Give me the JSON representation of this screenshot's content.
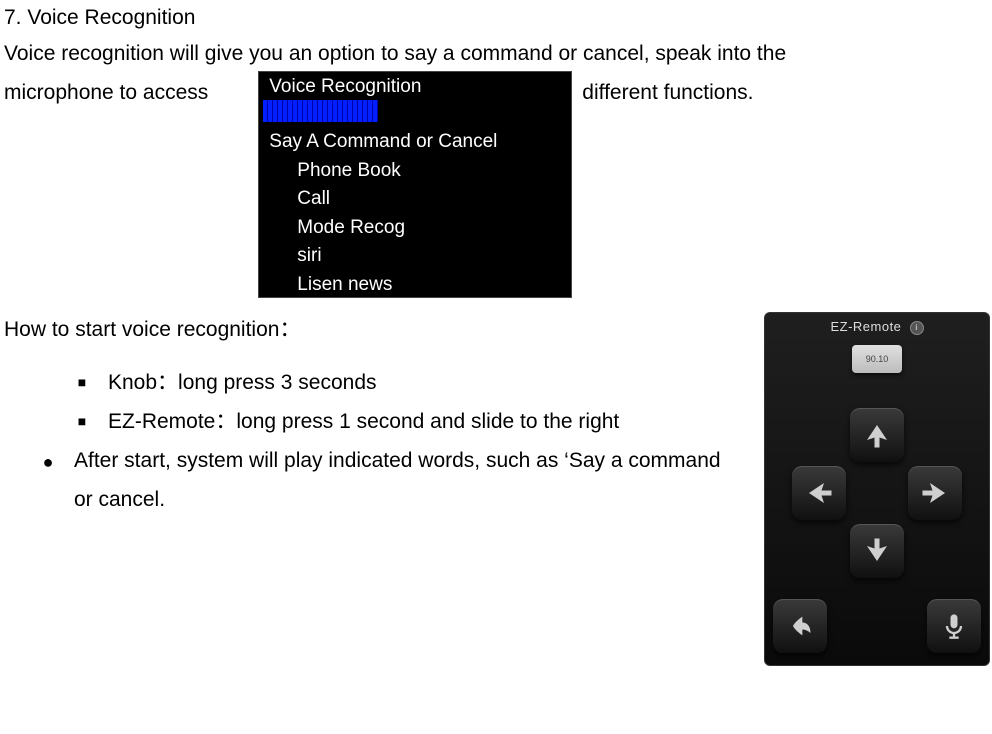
{
  "section": {
    "heading": "7. Voice Recognition",
    "intro_line1": "Voice recognition will give you an option to say a command or cancel, speak into the",
    "intro_left": "microphone to access",
    "intro_right": "different functions."
  },
  "vr_screen": {
    "title": "Voice Recognition",
    "prompt": "Say A Command or Cancel",
    "items": [
      "Phone Book",
      "Call",
      "Mode Recog",
      "siri",
      "Lisen news"
    ]
  },
  "howto": {
    "title": "How to start voice recognition：",
    "bullets_square": [
      "Knob：long press 3 seconds",
      "EZ-Remote：long press 1 second and slide to the right"
    ],
    "bullet_circle": "After start, system will play indicated words, such as ‘Say a command or cancel."
  },
  "remote": {
    "label": "EZ-Remote",
    "badge": "90.10",
    "icons": {
      "up": "arrow-up-icon",
      "down": "arrow-down-icon",
      "left": "arrow-left-icon",
      "right": "arrow-right-icon",
      "back": "back-icon",
      "mic": "microphone-icon"
    }
  }
}
